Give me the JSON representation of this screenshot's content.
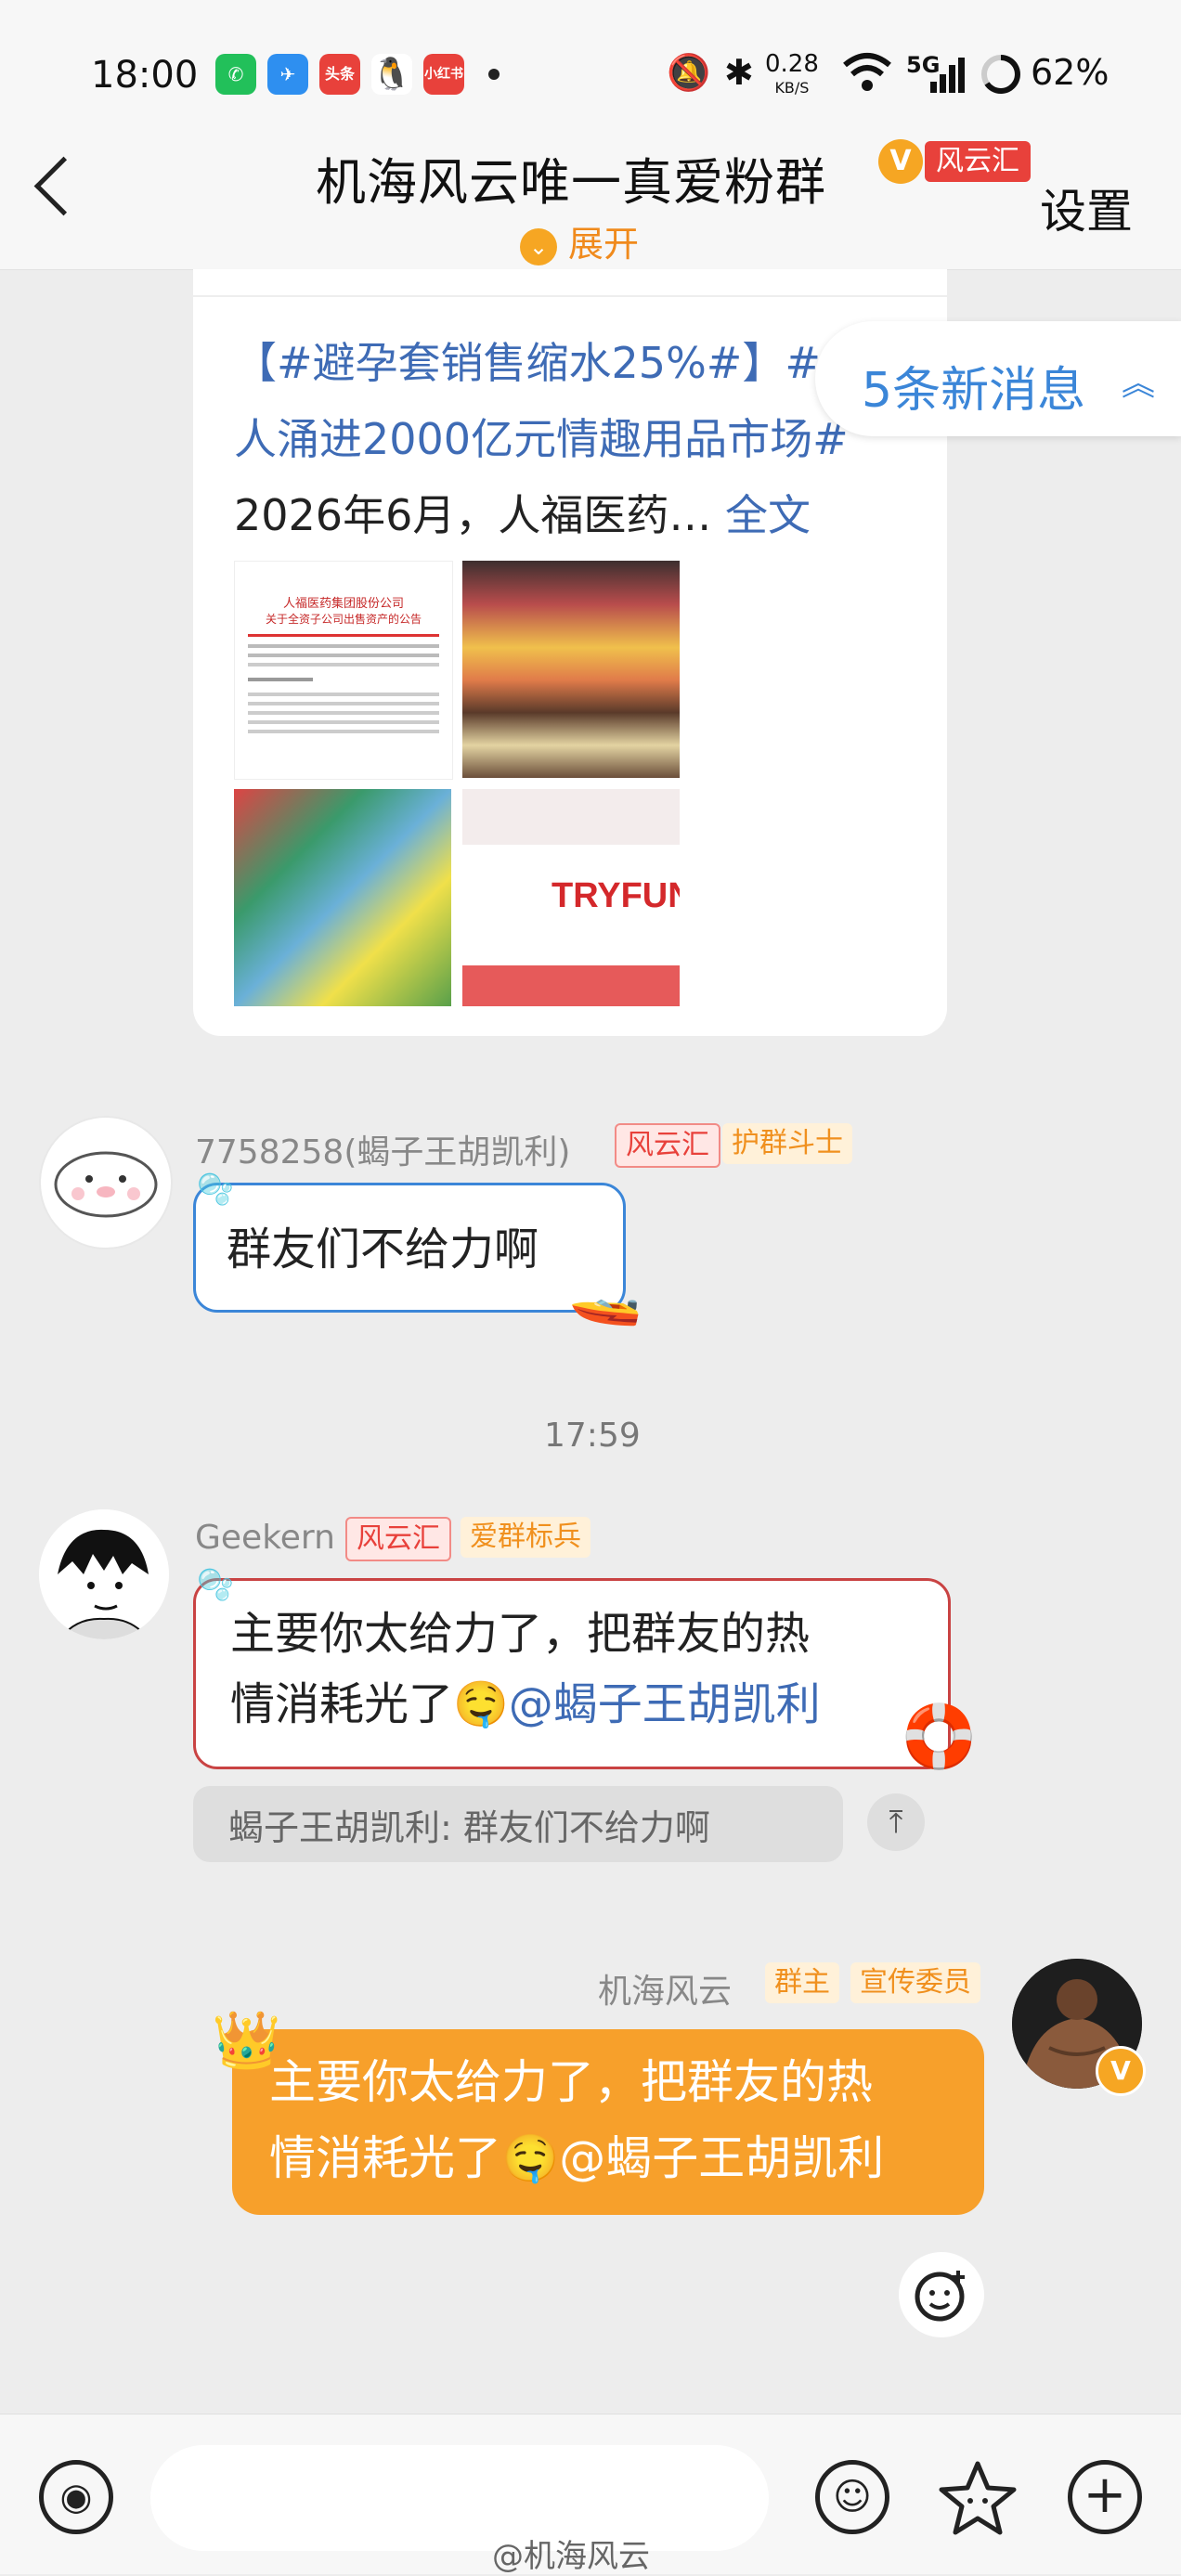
{
  "status_bar": {
    "time": "18:00",
    "apps": [
      {
        "name": "wechat-icon",
        "color": "#22c05a",
        "label": "✆"
      },
      {
        "name": "send-icon",
        "color": "#2e8ff0",
        "label": "✈"
      },
      {
        "name": "toutiao-icon",
        "color": "#e8413b",
        "label": "头条"
      },
      {
        "name": "qq-icon",
        "color": "#111111",
        "label": "♟"
      },
      {
        "name": "xiaohongshu-icon",
        "color": "#e8413b",
        "label": "小红书"
      }
    ],
    "net_speed": "0.28",
    "net_unit": "KB/S",
    "signal": "5G",
    "battery": "62%"
  },
  "header": {
    "title": "机海风云唯一真爱粉群",
    "tag": "风云汇",
    "expand": "展开",
    "settings": "设置"
  },
  "new_messages": {
    "label": "5条新消息"
  },
  "shared_post": {
    "topic1": "【#避孕套销售缩水25%#】#年",
    "line2_topic": "人涌进2000亿元情趣用品市场#",
    "line3": "2026年6月，人福医药… ",
    "full_text": "全文",
    "doc_title": "人福医药集团股份公司",
    "doc_subtitle": "关于全资子公司出售资产的公告",
    "tryfun_brand": "TRYFUN"
  },
  "messages": [
    {
      "nick": "7758258(蝎子王胡凯利)",
      "tags": [
        "风云汇",
        "护群斗士"
      ],
      "text": "群友们不给力啊"
    },
    {
      "nick": "Geekern",
      "tags": [
        "风云汇",
        "爱群标兵"
      ],
      "text_line1": "主要你太给力了，把群友的热",
      "text_line2": "情消耗光了",
      "mention": "@蝎子王胡凯利",
      "quote": "蝎子王胡凯利: 群友们不给力啊"
    },
    {
      "nick": "机海风云",
      "tags": [
        "群主",
        "宣传委员"
      ],
      "text_line1": "主要你太给力了，把群友的热",
      "text_line2": "情消耗光了",
      "mention": "@蝎子王胡凯利"
    }
  ],
  "timestamp": "17:59",
  "watermark": "@机海风云"
}
